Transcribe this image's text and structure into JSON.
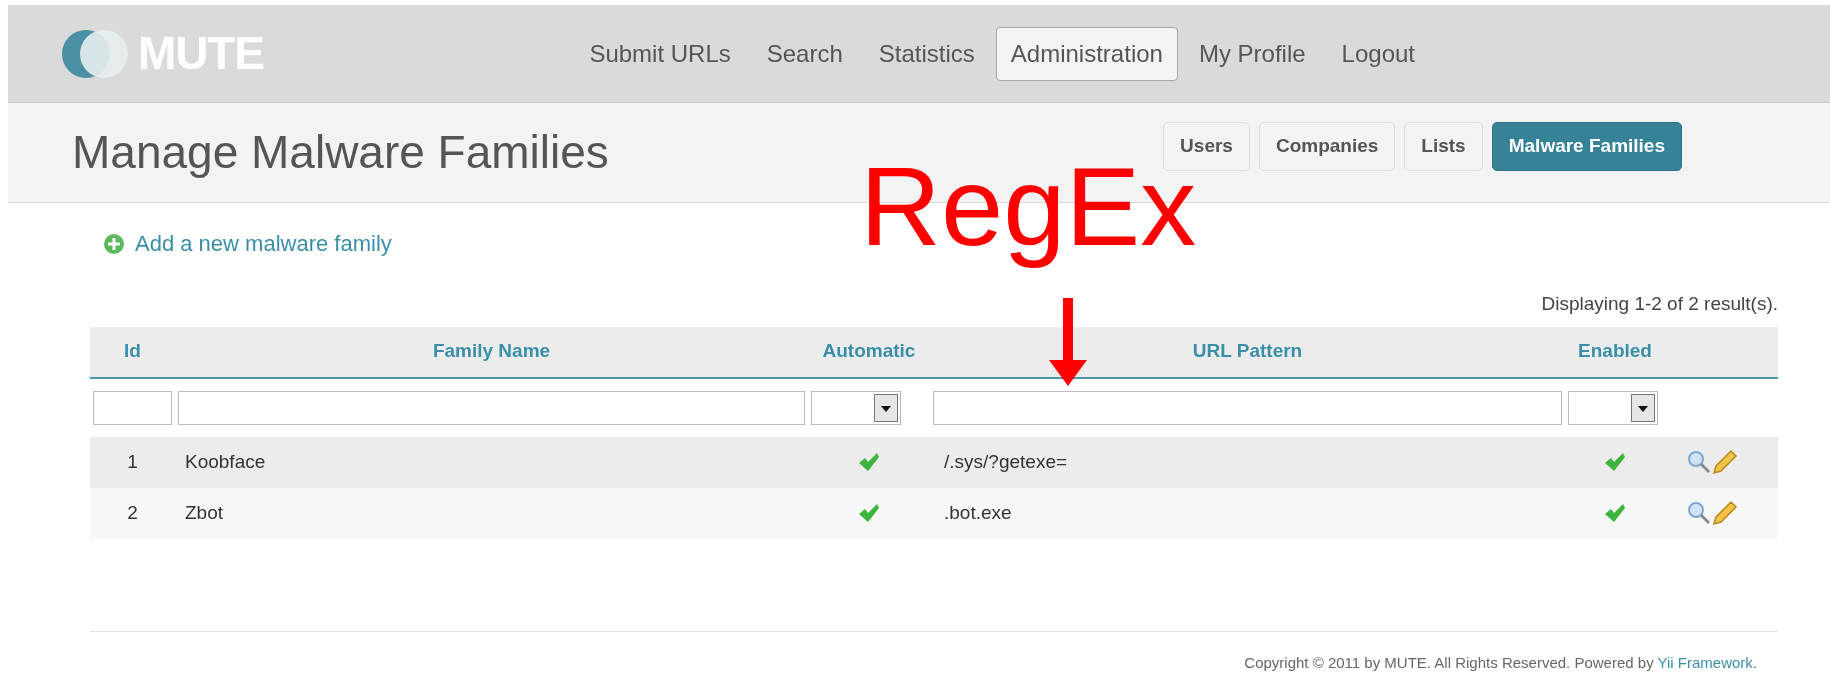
{
  "logo": {
    "text": "MUTE"
  },
  "nav": [
    {
      "label": "Submit URLs",
      "selected": false
    },
    {
      "label": "Search",
      "selected": false
    },
    {
      "label": "Statistics",
      "selected": false
    },
    {
      "label": "Administration",
      "selected": true
    },
    {
      "label": "My Profile",
      "selected": false
    },
    {
      "label": "Logout",
      "selected": false
    }
  ],
  "page_title": "Manage Malware Families",
  "subtabs": [
    {
      "label": "Users",
      "selected": false
    },
    {
      "label": "Companies",
      "selected": false
    },
    {
      "label": "Lists",
      "selected": false
    },
    {
      "label": "Malware Families",
      "selected": true
    }
  ],
  "add_link": "Add a new malware family",
  "summary": "Displaying 1-2 of 2 result(s).",
  "table": {
    "columns": [
      {
        "label": "Id",
        "kind": "text"
      },
      {
        "label": "Family Name",
        "kind": "text"
      },
      {
        "label": "Automatic",
        "kind": "select"
      },
      {
        "label": "URL Pattern",
        "kind": "text"
      },
      {
        "label": "Enabled",
        "kind": "select"
      }
    ],
    "rows": [
      {
        "id": "1",
        "name": "Koobface",
        "automatic": true,
        "pattern": "/.sys/?getexe=",
        "enabled": true
      },
      {
        "id": "2",
        "name": "Zbot",
        "automatic": true,
        "pattern": ".bot.exe",
        "enabled": true
      }
    ]
  },
  "annotation": {
    "text": "RegEx"
  },
  "footer": {
    "text": "Copyright © 2011 by MUTE. All Rights Reserved. Powered by ",
    "link": "Yii Framework",
    "end": "."
  }
}
